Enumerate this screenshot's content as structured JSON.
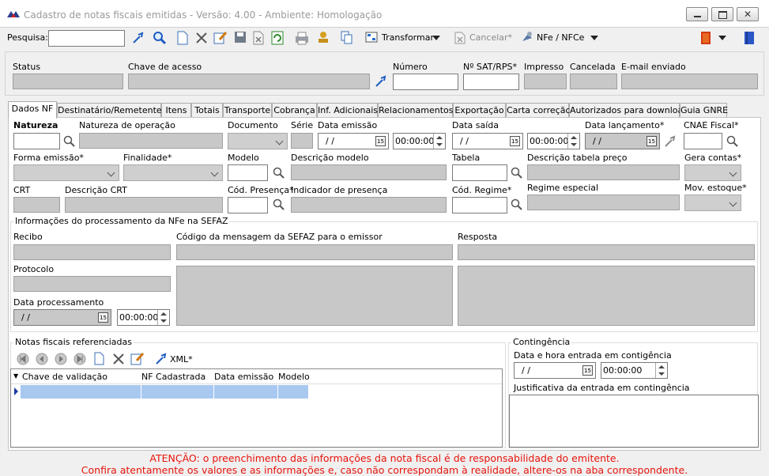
{
  "window": {
    "title": "Cadastro de notas fiscais emitidas - Versão: 4.00 - Ambiente: Homologação"
  },
  "toolbar": {
    "search_label": "Pesquisa:",
    "search_value": "",
    "transform_label": "Transformar",
    "cancel_label": "Cancelar*",
    "nfe_label": "NFe / NFCe"
  },
  "header": {
    "status_label": "Status",
    "chave_label": "Chave de acesso",
    "numero_label": "Número",
    "sat_label": "Nº SAT/RPS*",
    "impresso_label": "Impresso",
    "cancelada_label": "Cancelada",
    "email_label": "E-mail enviado"
  },
  "tabs": [
    {
      "label": "Dados NF"
    },
    {
      "label": "Destinatário/Remetente"
    },
    {
      "label": "Itens"
    },
    {
      "label": "Totais"
    },
    {
      "label": "Transporte"
    },
    {
      "label": "Cobrança"
    },
    {
      "label": "Inf. Adicionais"
    },
    {
      "label": "Relacionamentos"
    },
    {
      "label": "Exportação"
    },
    {
      "label": "Carta correção"
    },
    {
      "label": "Autorizados para download"
    },
    {
      "label": "Guia GNRE"
    }
  ],
  "form": {
    "natureza_label": "Natureza",
    "natureza_op_label": "Natureza de operação",
    "documento_label": "Documento",
    "serie_label": "Série",
    "data_emissao_label": "Data emissão",
    "data_saida_label": "Data saída",
    "data_lancamento_label": "Data lançamento*",
    "cnae_label": "CNAE Fiscal*",
    "forma_emissao_label": "Forma emissão*",
    "finalidade_label": "Finalidade*",
    "modelo_label": "Modelo",
    "descricao_modelo_label": "Descrição modelo",
    "tabela_label": "Tabela",
    "descricao_tabela_label": "Descrição tabela preço",
    "gera_contas_label": "Gera contas*",
    "crt_label": "CRT",
    "descricao_crt_label": "Descrição CRT",
    "cod_presenca_label": "Cód. Presença*",
    "indicador_presenca_label": "Indicador de presença",
    "cod_regime_label": "Cód. Regime*",
    "regime_especial_label": "Regime especial",
    "mov_estoque_label": "Mov. estoque*",
    "date_empty": "/ /",
    "time_zero": "00:00:00"
  },
  "sefaz": {
    "group_title": "Informações do processamento da NFe na SEFAZ",
    "recibo_label": "Recibo",
    "codigo_msg_label": "Código da mensagem da SEFAZ para o emissor",
    "resposta_label": "Resposta",
    "protocolo_label": "Protocolo",
    "data_proc_label": "Data processamento"
  },
  "referenciadas": {
    "group_title": "Notas fiscais referenciadas",
    "xml_label": "XML*",
    "columns": [
      "Chave de validação",
      "NF Cadastrada",
      "Data emissão",
      "Modelo"
    ]
  },
  "contingencia": {
    "group_title": "Contingência",
    "data_hora_label": "Data e hora entrada em contigência",
    "justificativa_label": "Justificativa da entrada em contingência"
  },
  "footer": {
    "line1": "ATENÇÃO: o preenchimento das informações da nota fiscal é de responsabilidade do emitente.",
    "line2": "Confira atentamente os valores e as informações e, caso não correspondam à realidade, altere-os na aba correspondente."
  },
  "colors": {
    "warning": "#e8140c",
    "grid_selection": "#a8c8f0"
  }
}
